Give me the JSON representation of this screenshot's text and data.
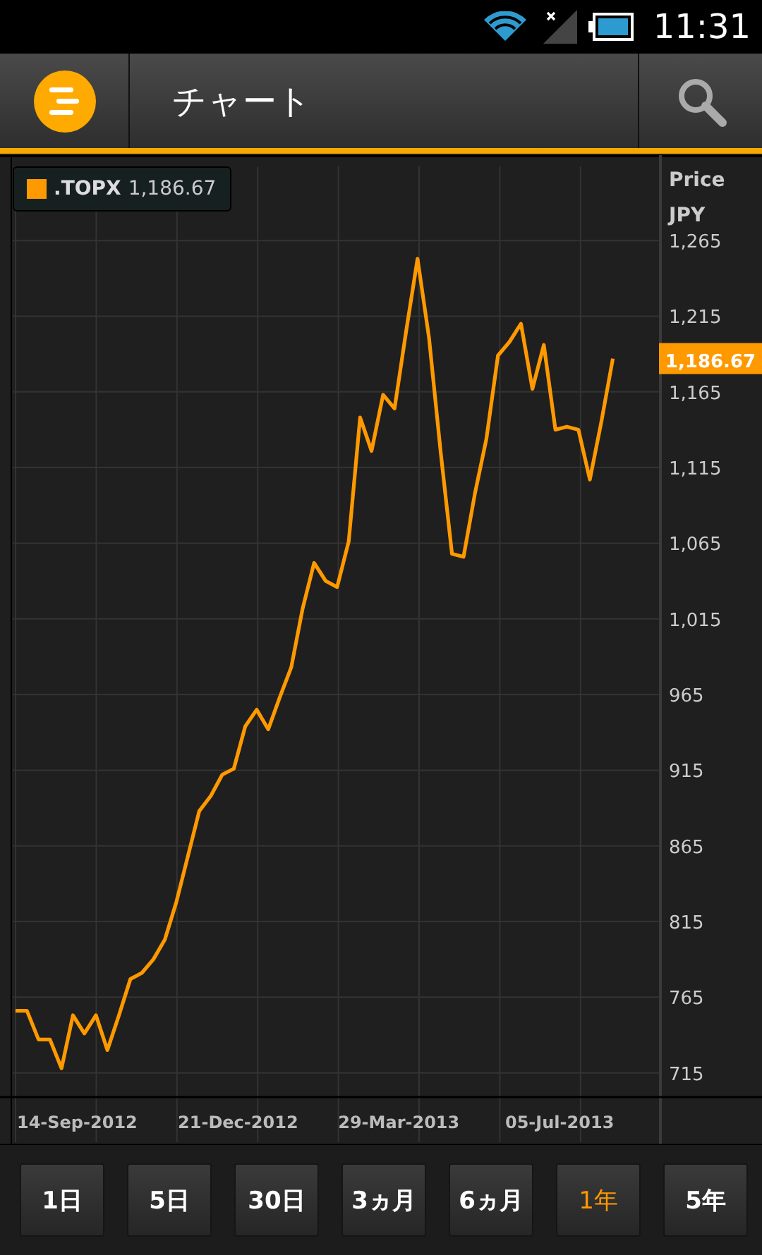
{
  "status_bar": {
    "time": "11:31"
  },
  "header": {
    "title": "チャート"
  },
  "legend": {
    "value": "1,186.67"
  },
  "price_axis": {
    "title": "Price",
    "unit": "JPY",
    "tag": "1,186.67"
  },
  "chart": {
    "chart_data": {
      "type": "line",
      "ylim": [
        699,
        1314
      ],
      "grid": true,
      "categories": [
        null,
        null,
        null,
        null,
        null,
        "14-Sep-2012",
        null,
        null,
        null,
        null,
        null,
        null,
        null,
        null,
        null,
        null,
        null,
        null,
        null,
        "21-Dec-2012",
        null,
        null,
        null,
        null,
        null,
        null,
        null,
        null,
        null,
        null,
        null,
        null,
        null,
        "29-Mar-2013",
        null,
        null,
        null,
        null,
        null,
        null,
        null,
        null,
        null,
        null,
        null,
        null,
        null,
        "05-Jul-2013",
        null,
        null,
        null,
        null,
        null
      ],
      "series": [
        {
          "name": ".TOPX",
          "color": "#ff9900",
          "values": [
            756,
            756,
            737,
            737,
            718,
            753,
            741,
            753,
            730,
            753,
            777,
            781,
            790,
            803,
            828,
            858,
            888,
            898,
            912,
            916,
            944,
            955,
            942,
            963,
            983,
            1022,
            1052,
            1040,
            1036,
            1066,
            1148,
            1126,
            1163,
            1154,
            1205,
            1253,
            1201,
            1126,
            1058,
            1056,
            1098,
            1134,
            1189,
            1198,
            1210,
            1167,
            1196,
            1140,
            1142,
            1140,
            1107,
            1145,
            1187
          ]
        }
      ],
      "yticks": [
        {
          "value": 715,
          "label": "715"
        },
        {
          "value": 765,
          "label": "765"
        },
        {
          "value": 815,
          "label": "815"
        },
        {
          "value": 865,
          "label": "865"
        },
        {
          "value": 915,
          "label": "915"
        },
        {
          "value": 965,
          "label": "965"
        },
        {
          "value": 1015,
          "label": "1,015"
        },
        {
          "value": 1065,
          "label": "1,065"
        },
        {
          "value": 1115,
          "label": "1,115"
        },
        {
          "value": 1165,
          "label": "1,165"
        },
        {
          "value": 1215,
          "label": "1,215"
        },
        {
          "value": 1265,
          "label": "1,265"
        }
      ]
    }
  },
  "periods": [
    {
      "label": "1日",
      "selected": false
    },
    {
      "label": "5日",
      "selected": false
    },
    {
      "label": "30日",
      "selected": false
    },
    {
      "label": "3ヵ月",
      "selected": false
    },
    {
      "label": "6ヵ月",
      "selected": false
    },
    {
      "label": "1年",
      "selected": true
    },
    {
      "label": "5年",
      "selected": false
    }
  ]
}
